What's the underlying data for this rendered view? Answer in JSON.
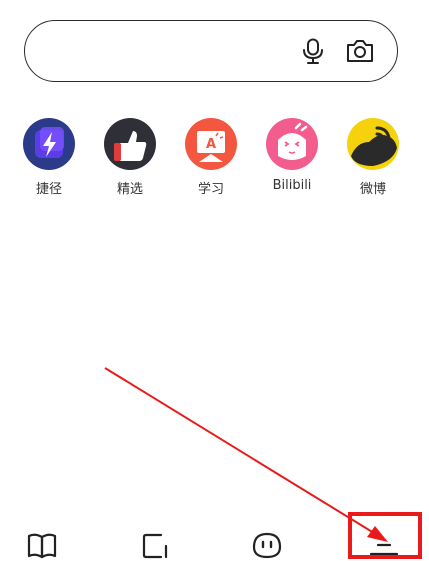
{
  "search": {
    "placeholder": "",
    "icons": [
      "microphone-icon",
      "camera-icon"
    ]
  },
  "quick_apps": [
    {
      "label": "捷径",
      "icon": "shortcut-bolt-icon",
      "color": "#4b3bd6"
    },
    {
      "label": "精选",
      "icon": "thumbs-up-icon",
      "color": "#2e2e3a"
    },
    {
      "label": "学习",
      "icon": "study-board-icon",
      "color": "#f0563f"
    },
    {
      "label": "Bilibili",
      "icon": "bilibili-mascot-icon",
      "color": "#f25d8e"
    },
    {
      "label": "微博",
      "icon": "weibo-icon",
      "color": "#f5d20c"
    }
  ],
  "bottom_nav": [
    {
      "name": "book-icon"
    },
    {
      "name": "tabs-icon"
    },
    {
      "name": "smiley-icon"
    },
    {
      "name": "menu-icon"
    }
  ],
  "annotation": {
    "arrow_color": "#ea1a1a",
    "highlight_color": "#ea1a1a"
  }
}
